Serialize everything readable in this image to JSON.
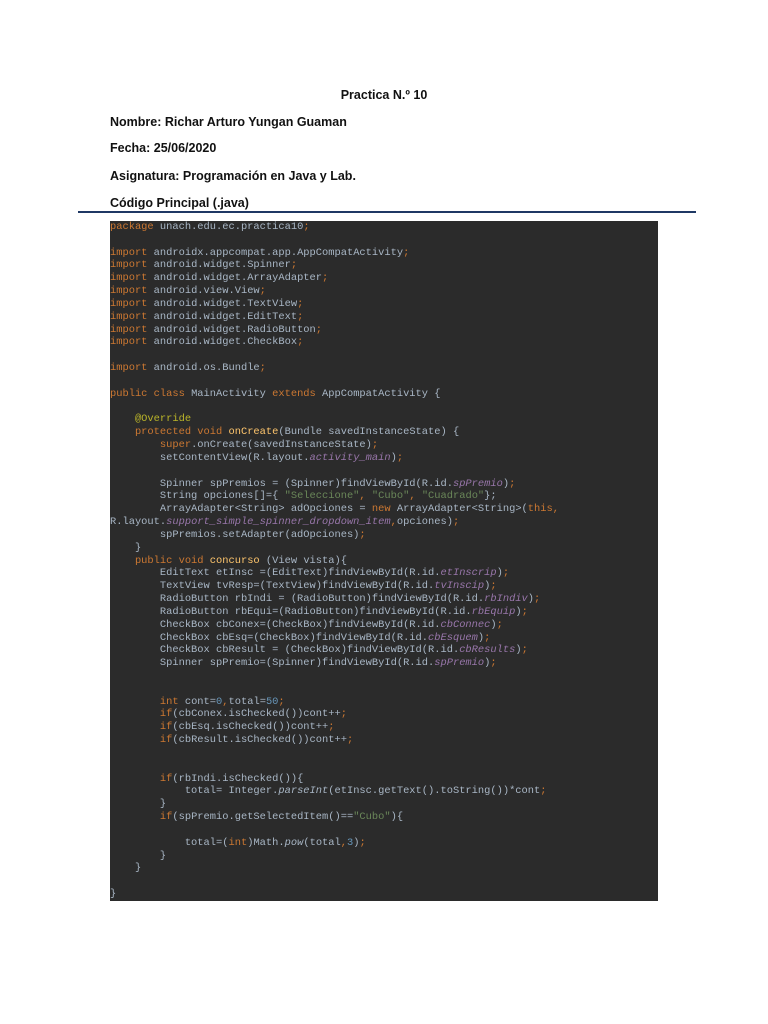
{
  "document": {
    "title": "Practica N.º 10",
    "nombre": "Nombre: Richar Arturo Yungan Guaman",
    "fecha": "Fecha: 25/06/2020",
    "asignatura": "Asignatura: Programación en Java y Lab.",
    "section": "Código Principal (.java)"
  },
  "code_lines": [
    [
      [
        "package",
        "k"
      ],
      [
        " unach.edu.ec.practica10",
        "p"
      ],
      [
        ";",
        "k"
      ]
    ],
    [],
    [
      [
        "import",
        "k"
      ],
      [
        " androidx.appcompat.app.AppCompatActivity",
        "p"
      ],
      [
        ";",
        "k"
      ]
    ],
    [
      [
        "import",
        "k"
      ],
      [
        " android.widget.Spinner",
        "p"
      ],
      [
        ";",
        "k"
      ]
    ],
    [
      [
        "import",
        "k"
      ],
      [
        " android.widget.ArrayAdapter",
        "p"
      ],
      [
        ";",
        "k"
      ]
    ],
    [
      [
        "import",
        "k"
      ],
      [
        " android.view.View",
        "p"
      ],
      [
        ";",
        "k"
      ]
    ],
    [
      [
        "import",
        "k"
      ],
      [
        " android.widget.TextView",
        "p"
      ],
      [
        ";",
        "k"
      ]
    ],
    [
      [
        "import",
        "k"
      ],
      [
        " android.widget.EditText",
        "p"
      ],
      [
        ";",
        "k"
      ]
    ],
    [
      [
        "import",
        "k"
      ],
      [
        " android.widget.RadioButton",
        "p"
      ],
      [
        ";",
        "k"
      ]
    ],
    [
      [
        "import",
        "k"
      ],
      [
        " android.widget.CheckBox",
        "p"
      ],
      [
        ";",
        "k"
      ]
    ],
    [],
    [
      [
        "import",
        "k"
      ],
      [
        " android.os.Bundle",
        "p"
      ],
      [
        ";",
        "k"
      ]
    ],
    [],
    [
      [
        "public class ",
        "k"
      ],
      [
        "MainActivity ",
        "p"
      ],
      [
        "extends ",
        "k"
      ],
      [
        "AppCompatActivity {",
        "p"
      ]
    ],
    [],
    [
      [
        "    @Override",
        "a"
      ]
    ],
    [
      [
        "    protected void ",
        "k"
      ],
      [
        "onCreate",
        "m"
      ],
      [
        "(Bundle savedInstanceState) {",
        "p"
      ]
    ],
    [
      [
        "        super",
        "k"
      ],
      [
        ".onCreate(savedInstanceState)",
        "p"
      ],
      [
        ";",
        "k"
      ]
    ],
    [
      [
        "        setContentView(R.layout.",
        "p"
      ],
      [
        "activity_main",
        "i"
      ],
      [
        ")",
        "p"
      ],
      [
        ";",
        "k"
      ]
    ],
    [],
    [
      [
        "        Spinner spPremios = (Spinner)findViewById(R.id.",
        "p"
      ],
      [
        "spPremio",
        "i"
      ],
      [
        ")",
        "p"
      ],
      [
        ";",
        "k"
      ]
    ],
    [
      [
        "        String opciones[]={ ",
        "p"
      ],
      [
        "\"Seleccione\"",
        "s"
      ],
      [
        ", ",
        "k"
      ],
      [
        "\"Cubo\"",
        "s"
      ],
      [
        ", ",
        "k"
      ],
      [
        "\"Cuadrado\"",
        "s"
      ],
      [
        "};",
        "p"
      ]
    ],
    [
      [
        "        ArrayAdapter<String> adOpciones = ",
        "p"
      ],
      [
        "new ",
        "k"
      ],
      [
        "ArrayAdapter<String>(",
        "p"
      ],
      [
        "this,",
        "k"
      ]
    ],
    [
      [
        "R.layout.",
        "p"
      ],
      [
        "support_simple_spinner_dropdown_item",
        "i"
      ],
      [
        ",",
        "k"
      ],
      [
        "opciones)",
        "p"
      ],
      [
        ";",
        "k"
      ]
    ],
    [
      [
        "        spPremios.setAdapter(adOpciones)",
        "p"
      ],
      [
        ";",
        "k"
      ]
    ],
    [
      [
        "    }",
        "p"
      ]
    ],
    [
      [
        "    public void ",
        "k"
      ],
      [
        "concurso ",
        "m"
      ],
      [
        "(View vista){",
        "p"
      ]
    ],
    [
      [
        "        EditText etInsc =(EditText)findViewById(R.id.",
        "p"
      ],
      [
        "etInscrip",
        "i"
      ],
      [
        ")",
        "p"
      ],
      [
        ";",
        "k"
      ]
    ],
    [
      [
        "        TextView tvResp=(TextView)findViewById(R.id.",
        "p"
      ],
      [
        "tvInscip",
        "i"
      ],
      [
        ")",
        "p"
      ],
      [
        ";",
        "k"
      ]
    ],
    [
      [
        "        RadioButton rbIndi = (RadioButton)findViewById(R.id.",
        "p"
      ],
      [
        "rbIndiv",
        "i"
      ],
      [
        ")",
        "p"
      ],
      [
        ";",
        "k"
      ]
    ],
    [
      [
        "        RadioButton rbEqui=(RadioButton)findViewById(R.id.",
        "p"
      ],
      [
        "rbEquip",
        "i"
      ],
      [
        ")",
        "p"
      ],
      [
        ";",
        "k"
      ]
    ],
    [
      [
        "        CheckBox cbConex=(CheckBox)findViewById(R.id.",
        "p"
      ],
      [
        "cbConnec",
        "i"
      ],
      [
        ")",
        "p"
      ],
      [
        ";",
        "k"
      ]
    ],
    [
      [
        "        CheckBox cbEsq=(CheckBox)findViewById(R.id.",
        "p"
      ],
      [
        "cbEsquem",
        "i"
      ],
      [
        ")",
        "p"
      ],
      [
        ";",
        "k"
      ]
    ],
    [
      [
        "        CheckBox cbResult = (CheckBox)findViewById(R.id.",
        "p"
      ],
      [
        "cbResults",
        "i"
      ],
      [
        ")",
        "p"
      ],
      [
        ";",
        "k"
      ]
    ],
    [
      [
        "        Spinner spPremio=(Spinner)findViewById(R.id.",
        "p"
      ],
      [
        "spPremio",
        "i"
      ],
      [
        ")",
        "p"
      ],
      [
        ";",
        "k"
      ]
    ],
    [],
    [],
    [
      [
        "        int ",
        "k"
      ],
      [
        "cont=",
        "p"
      ],
      [
        "0",
        "n"
      ],
      [
        ",",
        "k"
      ],
      [
        "total=",
        "p"
      ],
      [
        "50",
        "n"
      ],
      [
        ";",
        "k"
      ]
    ],
    [
      [
        "        if",
        "k"
      ],
      [
        "(cbConex.isChecked())cont++",
        "p"
      ],
      [
        ";",
        "k"
      ]
    ],
    [
      [
        "        if",
        "k"
      ],
      [
        "(cbEsq.isChecked())cont++",
        "p"
      ],
      [
        ";",
        "k"
      ]
    ],
    [
      [
        "        if",
        "k"
      ],
      [
        "(cbResult.isChecked())cont++",
        "p"
      ],
      [
        ";",
        "k"
      ]
    ],
    [],
    [],
    [
      [
        "        if",
        "k"
      ],
      [
        "(rbIndi.isChecked()){",
        "p"
      ]
    ],
    [
      [
        "            total= Integer.",
        "p"
      ],
      [
        "parseInt",
        "it"
      ],
      [
        "(etInsc.getText().toString())*cont",
        "p"
      ],
      [
        ";",
        "k"
      ]
    ],
    [
      [
        "        }",
        "p"
      ]
    ],
    [
      [
        "        if",
        "k"
      ],
      [
        "(spPremio.getSelectedItem()==",
        "p"
      ],
      [
        "\"Cubo\"",
        "s"
      ],
      [
        "){",
        "p"
      ]
    ],
    [],
    [
      [
        "            total=(",
        "p"
      ],
      [
        "int",
        "k"
      ],
      [
        ")Math.",
        "p"
      ],
      [
        "pow",
        "it"
      ],
      [
        "(total",
        "p"
      ],
      [
        ",",
        "k"
      ],
      [
        "3",
        "n"
      ],
      [
        ")",
        "p"
      ],
      [
        ";",
        "k"
      ]
    ],
    [
      [
        "        }",
        "p"
      ]
    ],
    [
      [
        "    }",
        "p"
      ]
    ],
    [],
    [
      [
        "}",
        "p"
      ]
    ]
  ],
  "colors": {
    "code_bg": "#2b2b2b",
    "keyword": "#cc7832",
    "plain": "#a9b7c6",
    "string": "#6a8759",
    "number": "#6897bb",
    "field": "#9876aa",
    "method": "#ffc66d",
    "annotation": "#bbb529",
    "rule": "#1f3864"
  }
}
